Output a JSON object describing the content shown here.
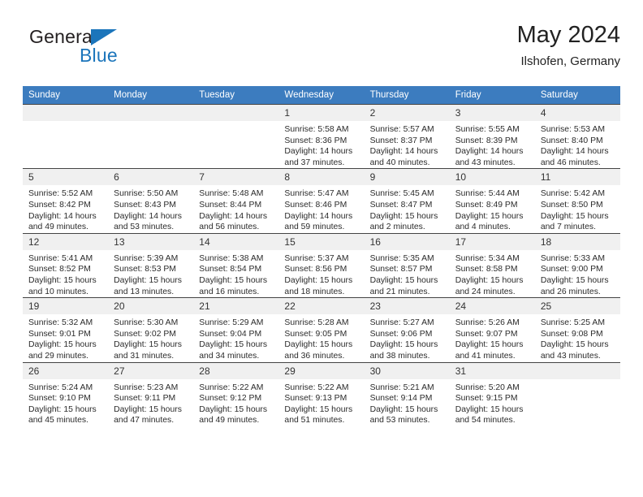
{
  "brand": {
    "name_part1": "General",
    "name_part2": "Blue",
    "triangle_color": "#1b75bb"
  },
  "header": {
    "title": "May 2024",
    "subtitle": "Ilshofen, Germany",
    "header_bg": "#3c7cbf"
  },
  "weekdays": [
    "Sunday",
    "Monday",
    "Tuesday",
    "Wednesday",
    "Thursday",
    "Friday",
    "Saturday"
  ],
  "labels": {
    "sunrise": "Sunrise:",
    "sunset": "Sunset:",
    "daylight": "Daylight:"
  },
  "weeks": [
    [
      {
        "day": "",
        "blank": true
      },
      {
        "day": "",
        "blank": true
      },
      {
        "day": "",
        "blank": true
      },
      {
        "day": "1",
        "sunrise": "Sunrise: 5:58 AM",
        "sunset": "Sunset: 8:36 PM",
        "daylight1": "Daylight: 14 hours",
        "daylight2": "and 37 minutes."
      },
      {
        "day": "2",
        "sunrise": "Sunrise: 5:57 AM",
        "sunset": "Sunset: 8:37 PM",
        "daylight1": "Daylight: 14 hours",
        "daylight2": "and 40 minutes."
      },
      {
        "day": "3",
        "sunrise": "Sunrise: 5:55 AM",
        "sunset": "Sunset: 8:39 PM",
        "daylight1": "Daylight: 14 hours",
        "daylight2": "and 43 minutes."
      },
      {
        "day": "4",
        "sunrise": "Sunrise: 5:53 AM",
        "sunset": "Sunset: 8:40 PM",
        "daylight1": "Daylight: 14 hours",
        "daylight2": "and 46 minutes."
      }
    ],
    [
      {
        "day": "5",
        "sunrise": "Sunrise: 5:52 AM",
        "sunset": "Sunset: 8:42 PM",
        "daylight1": "Daylight: 14 hours",
        "daylight2": "and 49 minutes."
      },
      {
        "day": "6",
        "sunrise": "Sunrise: 5:50 AM",
        "sunset": "Sunset: 8:43 PM",
        "daylight1": "Daylight: 14 hours",
        "daylight2": "and 53 minutes."
      },
      {
        "day": "7",
        "sunrise": "Sunrise: 5:48 AM",
        "sunset": "Sunset: 8:44 PM",
        "daylight1": "Daylight: 14 hours",
        "daylight2": "and 56 minutes."
      },
      {
        "day": "8",
        "sunrise": "Sunrise: 5:47 AM",
        "sunset": "Sunset: 8:46 PM",
        "daylight1": "Daylight: 14 hours",
        "daylight2": "and 59 minutes."
      },
      {
        "day": "9",
        "sunrise": "Sunrise: 5:45 AM",
        "sunset": "Sunset: 8:47 PM",
        "daylight1": "Daylight: 15 hours",
        "daylight2": "and 2 minutes."
      },
      {
        "day": "10",
        "sunrise": "Sunrise: 5:44 AM",
        "sunset": "Sunset: 8:49 PM",
        "daylight1": "Daylight: 15 hours",
        "daylight2": "and 4 minutes."
      },
      {
        "day": "11",
        "sunrise": "Sunrise: 5:42 AM",
        "sunset": "Sunset: 8:50 PM",
        "daylight1": "Daylight: 15 hours",
        "daylight2": "and 7 minutes."
      }
    ],
    [
      {
        "day": "12",
        "sunrise": "Sunrise: 5:41 AM",
        "sunset": "Sunset: 8:52 PM",
        "daylight1": "Daylight: 15 hours",
        "daylight2": "and 10 minutes."
      },
      {
        "day": "13",
        "sunrise": "Sunrise: 5:39 AM",
        "sunset": "Sunset: 8:53 PM",
        "daylight1": "Daylight: 15 hours",
        "daylight2": "and 13 minutes."
      },
      {
        "day": "14",
        "sunrise": "Sunrise: 5:38 AM",
        "sunset": "Sunset: 8:54 PM",
        "daylight1": "Daylight: 15 hours",
        "daylight2": "and 16 minutes."
      },
      {
        "day": "15",
        "sunrise": "Sunrise: 5:37 AM",
        "sunset": "Sunset: 8:56 PM",
        "daylight1": "Daylight: 15 hours",
        "daylight2": "and 18 minutes."
      },
      {
        "day": "16",
        "sunrise": "Sunrise: 5:35 AM",
        "sunset": "Sunset: 8:57 PM",
        "daylight1": "Daylight: 15 hours",
        "daylight2": "and 21 minutes."
      },
      {
        "day": "17",
        "sunrise": "Sunrise: 5:34 AM",
        "sunset": "Sunset: 8:58 PM",
        "daylight1": "Daylight: 15 hours",
        "daylight2": "and 24 minutes."
      },
      {
        "day": "18",
        "sunrise": "Sunrise: 5:33 AM",
        "sunset": "Sunset: 9:00 PM",
        "daylight1": "Daylight: 15 hours",
        "daylight2": "and 26 minutes."
      }
    ],
    [
      {
        "day": "19",
        "sunrise": "Sunrise: 5:32 AM",
        "sunset": "Sunset: 9:01 PM",
        "daylight1": "Daylight: 15 hours",
        "daylight2": "and 29 minutes."
      },
      {
        "day": "20",
        "sunrise": "Sunrise: 5:30 AM",
        "sunset": "Sunset: 9:02 PM",
        "daylight1": "Daylight: 15 hours",
        "daylight2": "and 31 minutes."
      },
      {
        "day": "21",
        "sunrise": "Sunrise: 5:29 AM",
        "sunset": "Sunset: 9:04 PM",
        "daylight1": "Daylight: 15 hours",
        "daylight2": "and 34 minutes."
      },
      {
        "day": "22",
        "sunrise": "Sunrise: 5:28 AM",
        "sunset": "Sunset: 9:05 PM",
        "daylight1": "Daylight: 15 hours",
        "daylight2": "and 36 minutes."
      },
      {
        "day": "23",
        "sunrise": "Sunrise: 5:27 AM",
        "sunset": "Sunset: 9:06 PM",
        "daylight1": "Daylight: 15 hours",
        "daylight2": "and 38 minutes."
      },
      {
        "day": "24",
        "sunrise": "Sunrise: 5:26 AM",
        "sunset": "Sunset: 9:07 PM",
        "daylight1": "Daylight: 15 hours",
        "daylight2": "and 41 minutes."
      },
      {
        "day": "25",
        "sunrise": "Sunrise: 5:25 AM",
        "sunset": "Sunset: 9:08 PM",
        "daylight1": "Daylight: 15 hours",
        "daylight2": "and 43 minutes."
      }
    ],
    [
      {
        "day": "26",
        "sunrise": "Sunrise: 5:24 AM",
        "sunset": "Sunset: 9:10 PM",
        "daylight1": "Daylight: 15 hours",
        "daylight2": "and 45 minutes."
      },
      {
        "day": "27",
        "sunrise": "Sunrise: 5:23 AM",
        "sunset": "Sunset: 9:11 PM",
        "daylight1": "Daylight: 15 hours",
        "daylight2": "and 47 minutes."
      },
      {
        "day": "28",
        "sunrise": "Sunrise: 5:22 AM",
        "sunset": "Sunset: 9:12 PM",
        "daylight1": "Daylight: 15 hours",
        "daylight2": "and 49 minutes."
      },
      {
        "day": "29",
        "sunrise": "Sunrise: 5:22 AM",
        "sunset": "Sunset: 9:13 PM",
        "daylight1": "Daylight: 15 hours",
        "daylight2": "and 51 minutes."
      },
      {
        "day": "30",
        "sunrise": "Sunrise: 5:21 AM",
        "sunset": "Sunset: 9:14 PM",
        "daylight1": "Daylight: 15 hours",
        "daylight2": "and 53 minutes."
      },
      {
        "day": "31",
        "sunrise": "Sunrise: 5:20 AM",
        "sunset": "Sunset: 9:15 PM",
        "daylight1": "Daylight: 15 hours",
        "daylight2": "and 54 minutes."
      },
      {
        "day": "",
        "blank": true
      }
    ]
  ]
}
